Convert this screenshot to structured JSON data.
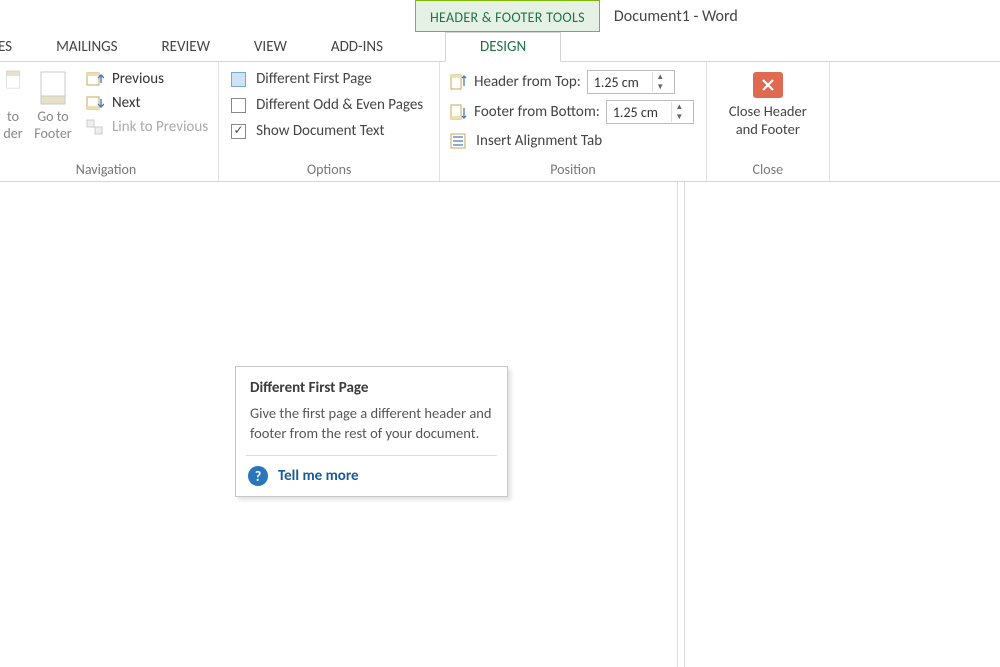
{
  "title": {
    "contextual": "HEADER & FOOTER TOOLS",
    "document": "Document1 - Word"
  },
  "tabs": {
    "t0": "CES",
    "t1": "MAILINGS",
    "t2": "REVIEW",
    "t3": "VIEW",
    "t4": "ADD-INS",
    "t5": "DESIGN"
  },
  "nav": {
    "goToHeader1": "to",
    "goToHeader2": "der",
    "goToFooter1": "Go to",
    "goToFooter2": "Footer",
    "previous": "Previous",
    "next": "Next",
    "link": "Link to Previous",
    "groupLabel": "Navigation"
  },
  "options": {
    "diffFirst": "Different First Page",
    "diffOddEven": "Different Odd & Even Pages",
    "showDoc": "Show Document Text",
    "groupLabel": "Options"
  },
  "position": {
    "headerFromTop": "Header from Top:",
    "footerFromBottom": "Footer from Bottom:",
    "headerValue": "1.25 cm",
    "footerValue": "1.25 cm",
    "insertAlign": "Insert Alignment Tab",
    "groupLabel": "Position"
  },
  "close": {
    "line1": "Close Header",
    "line2": "and Footer",
    "groupLabel": "Close"
  },
  "tooltip": {
    "title": "Different First Page",
    "body": "Give the first page a different header and footer from the rest of your document.",
    "more": "Tell me more"
  }
}
